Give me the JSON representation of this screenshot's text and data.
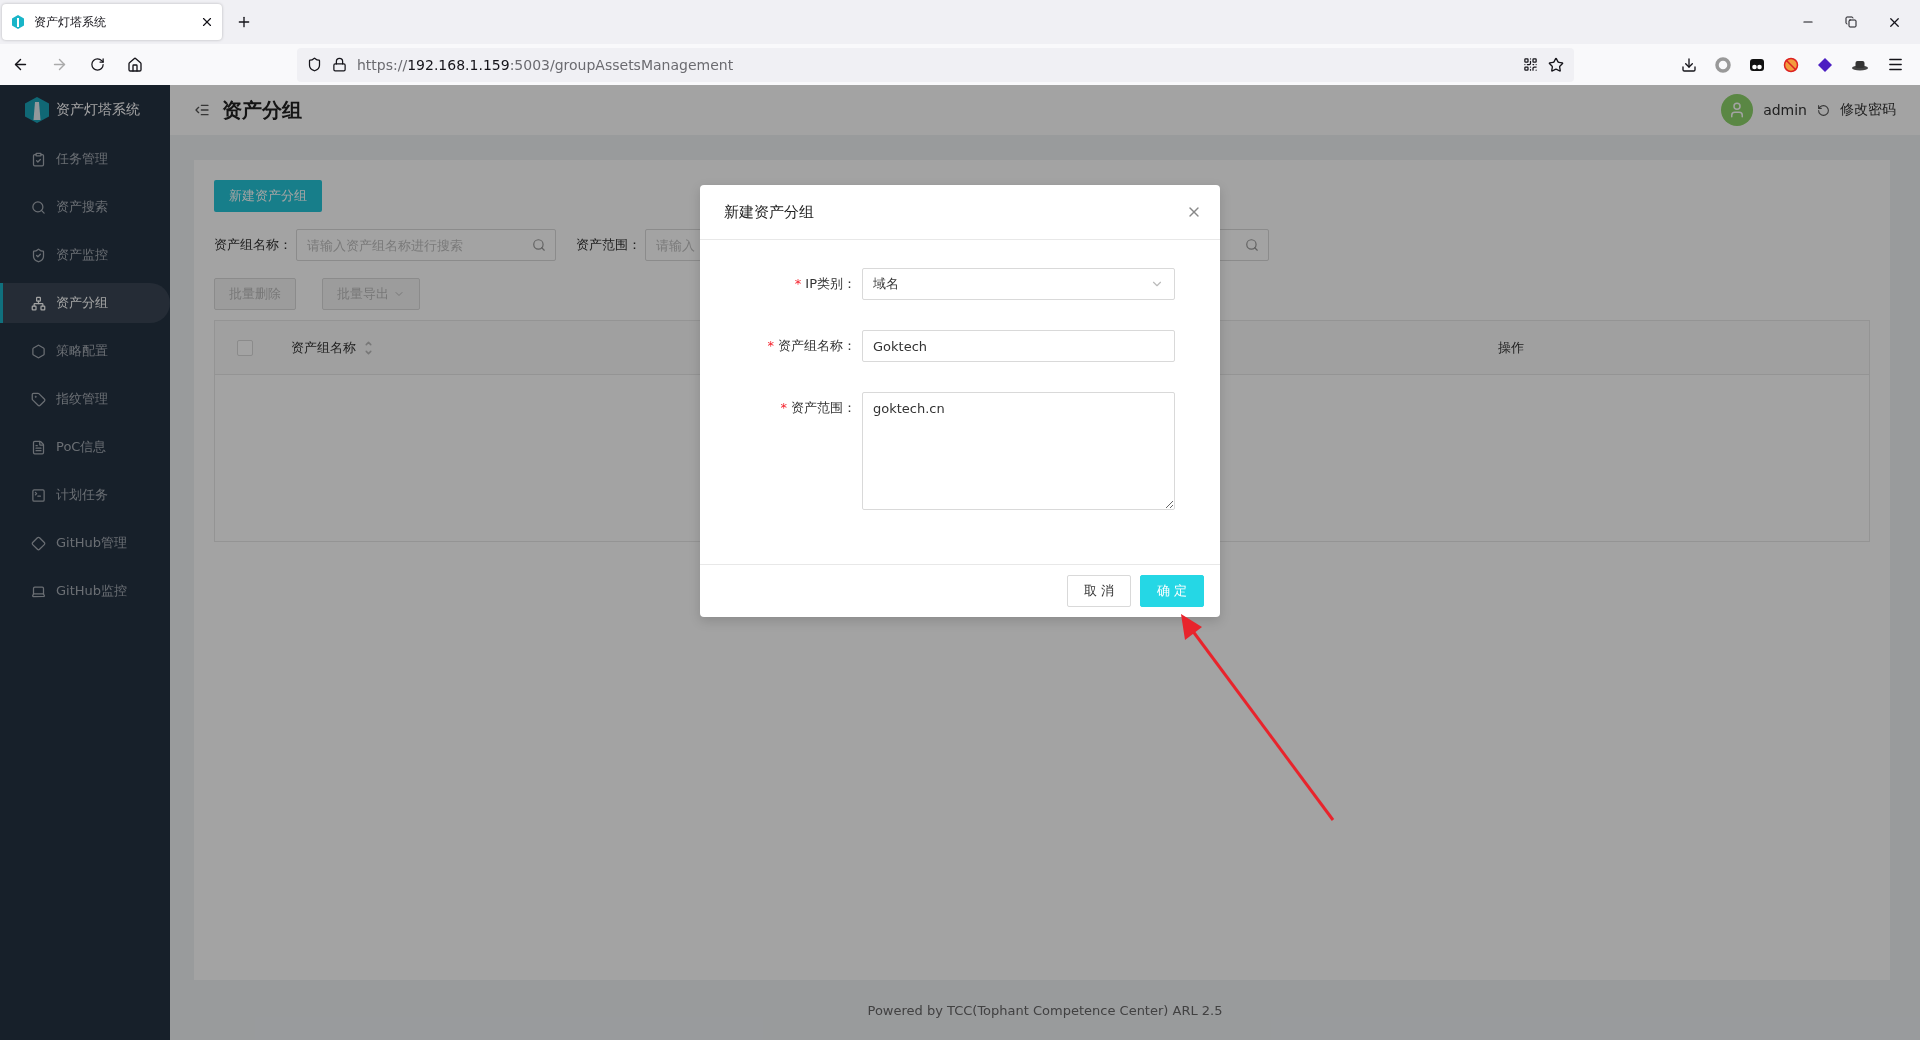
{
  "browser": {
    "tab": {
      "title": "资产灯塔系统"
    },
    "address": {
      "scheme": "https://",
      "host": "192.168.1.159",
      "rest": ":5003/groupAssetsManagement"
    }
  },
  "sidebar": {
    "brand": "资产灯塔系统",
    "items": [
      {
        "label": "任务管理",
        "selected": false
      },
      {
        "label": "资产搜索",
        "selected": false
      },
      {
        "label": "资产监控",
        "selected": false
      },
      {
        "label": "资产分组",
        "selected": true
      },
      {
        "label": "策略配置",
        "selected": false
      },
      {
        "label": "指纹管理",
        "selected": false
      },
      {
        "label": "PoC信息",
        "selected": false
      },
      {
        "label": "计划任务",
        "selected": false
      },
      {
        "label": "GitHub管理",
        "selected": false
      },
      {
        "label": "GitHub监控",
        "selected": false
      }
    ]
  },
  "header": {
    "title": "资产分组",
    "user": "admin",
    "change_password": "修改密码"
  },
  "toolbar": {
    "new_button": "新建资产分组",
    "filters": [
      {
        "label": "资产组名称：",
        "placeholder": "请输入资产组名称进行搜索"
      },
      {
        "label": "资产范围：",
        "placeholder": "请输入"
      }
    ],
    "actions": [
      {
        "label": "批量删除",
        "disabled": true,
        "dropdown": false
      },
      {
        "label": "批量导出",
        "disabled": true,
        "dropdown": true
      }
    ]
  },
  "table": {
    "header_checkbox": {
      "checked": false
    },
    "columns": [
      {
        "label": "资产组名称",
        "sortable": true
      },
      {
        "label": "操作",
        "sortable": false
      }
    ]
  },
  "dialog": {
    "title": "新建资产分组",
    "fields": [
      {
        "kind": "select",
        "mark": "*",
        "label": "IP类别：",
        "value": "域名"
      },
      {
        "kind": "input",
        "mark": "*",
        "label": "资产组名称：",
        "value": "Goktech"
      },
      {
        "kind": "textarea",
        "mark": "*",
        "label": "资产范围：",
        "value": "goktech.cn"
      }
    ],
    "buttons": [
      {
        "label": "取 消",
        "primary": false
      },
      {
        "label": "确 定",
        "primary": true
      }
    ]
  },
  "footer": "Powered by TCC(Tophant Competence Center) ARL 2.5"
}
